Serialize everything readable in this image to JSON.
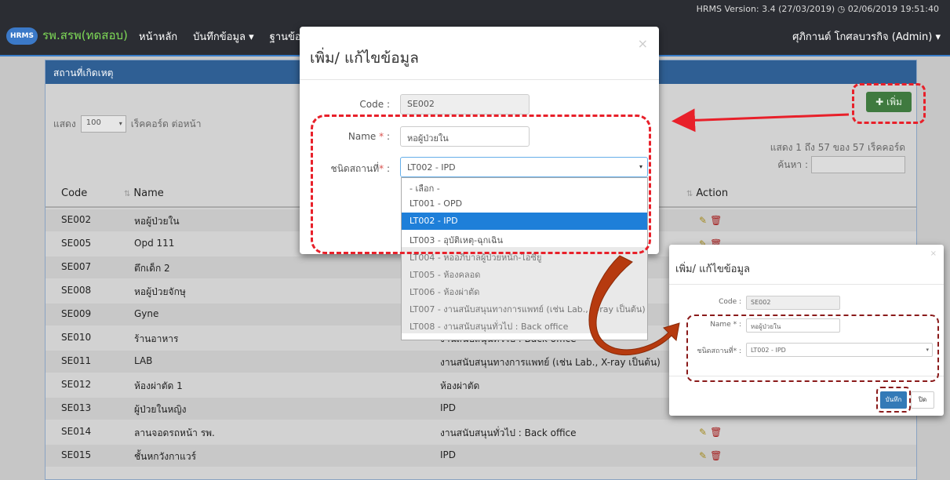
{
  "navbar": {
    "version": "HRMS Version: 3.4 (27/03/2019) ◷ 02/06/2019 19:51:40",
    "brand_badge": "HRMS",
    "brand_name": "รพ.สรพ(ทดสอบ)",
    "menu": [
      {
        "label": "หน้าหลัก"
      },
      {
        "label": "บันทึกข้อมูล ▾"
      },
      {
        "label": "ฐานข้อ"
      }
    ],
    "user": "ศุภิกานต์ โกศลบวรกิจ (Admin) ▾"
  },
  "panel": {
    "heading": "สถานที่เกิดเหตุ",
    "length_prefix": "แสดง",
    "length_value": "100",
    "length_suffix": "เร็คคอร์ด ต่อหน้า",
    "add_button": "✚ เพิ่ม",
    "info": "แสดง 1 ถึง 57 ของ 57 เร็คคอร์ด",
    "search_label": "ค้นหา :"
  },
  "table": {
    "headers": {
      "code": "Code",
      "name": "Name",
      "action": "Action"
    },
    "rows": [
      {
        "code": "SE002",
        "name": "หอผู้ป่วยใน",
        "type": ""
      },
      {
        "code": "SE005",
        "name": "Opd 111",
        "type": ""
      },
      {
        "code": "SE007",
        "name": "ตึกเด็ก 2",
        "type": ""
      },
      {
        "code": "SE008",
        "name": "หอผู้ป่วยจักษุ",
        "type": ""
      },
      {
        "code": "SE009",
        "name": "Gyne",
        "type": ""
      },
      {
        "code": "SE010",
        "name": "ร้านอาหาร",
        "type": "งานสนับสนุนทั่วไป : Back office"
      },
      {
        "code": "SE011",
        "name": "LAB",
        "type": "งานสนับสนุนทางการแพทย์ (เช่น Lab., X-ray เป็นต้น)"
      },
      {
        "code": "SE012",
        "name": "ห้องผ่าตัด 1",
        "type": "ห้องผ่าตัด"
      },
      {
        "code": "SE013",
        "name": "ผู้ป่วยในหญิง",
        "type": "IPD"
      },
      {
        "code": "SE014",
        "name": "ลานจอดรถหน้า รพ.",
        "type": "งานสนับสนุนทั่วไป : Back office"
      },
      {
        "code": "SE015",
        "name": "ชั้นหกวังกาแวร์",
        "type": "IPD"
      }
    ]
  },
  "modal": {
    "title": "เพิ่ม/ แก้ไขข้อมูล",
    "close": "×",
    "code_label": "Code :",
    "code_value": "SE002",
    "name_label": "Name",
    "name_label_suffix": " :",
    "required_mark": " *",
    "name_value": "หอผู้ป่วยใน",
    "type_label": "ชนิดสถานที่",
    "type_label_suffix": " :",
    "required_mark2": "*",
    "type_value": "LT002 - IPD",
    "caret": "▾"
  },
  "dropdown": {
    "options": [
      "- เลือก -",
      "LT001 - OPD",
      "LT002 - IPD",
      "LT003 - อุบัติเหตุ-ฉุกเฉิน",
      "LT004 - หออภิบาลผู้ป่วยหนัก-ไอซียู",
      "LT005 - ห้องคลอด",
      "LT006 - ห้องผ่าตัด",
      "LT007 - งานสนับสนุนทางการแพทย์ (เช่น Lab., X-ray เป็นต้น)",
      "LT008 - งานสนับสนุนทั่วไป : Back office"
    ],
    "selected_index": 2
  },
  "preview": {
    "title": "เพิ่ม/ แก้ไขข้อมูล",
    "close": "×",
    "code_label": "Code :",
    "code_value": "SE002",
    "name_label": "Name * :",
    "name_value": "หอผู้ป่วยใน",
    "type_label": "ชนิดสถานที่* :",
    "type_value": "LT002 - IPD",
    "save_button": "บันทึก",
    "close_button": "ปิด"
  },
  "colors": {
    "highlight": "#e8202a",
    "accent": "#337ab7",
    "arrow": "#b63a0f"
  }
}
